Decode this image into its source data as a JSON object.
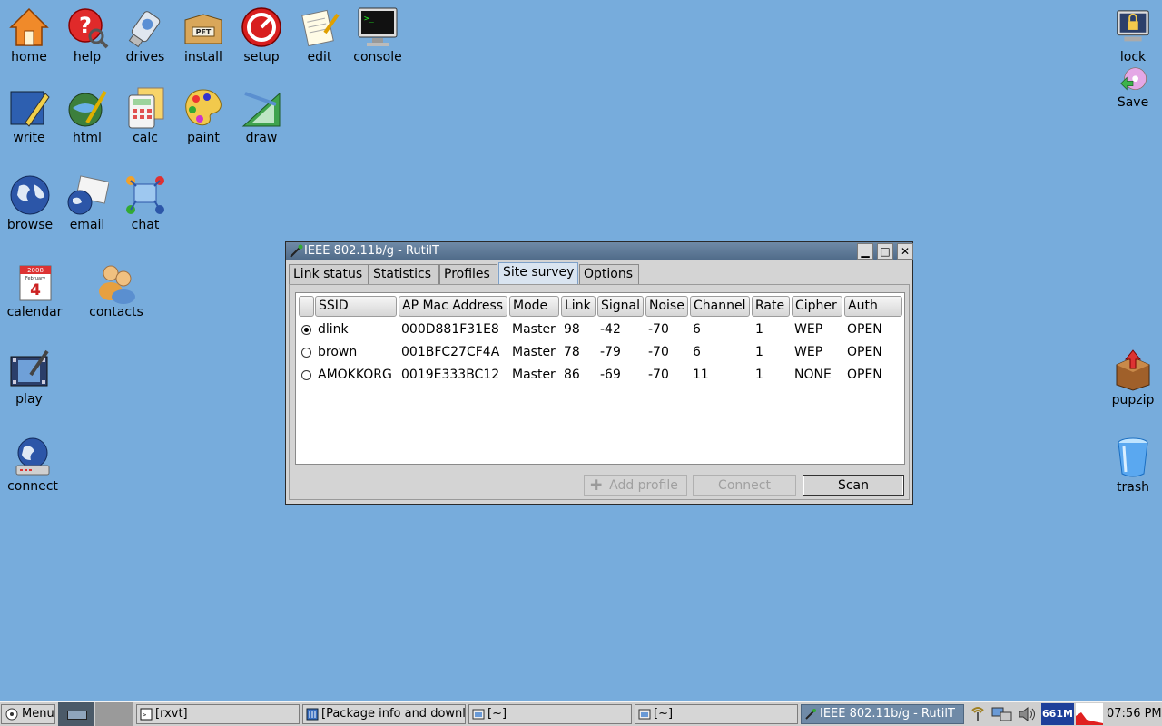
{
  "desktop_icons": {
    "home": "home",
    "help": "help",
    "drives": "drives",
    "install": "install",
    "setup": "setup",
    "edit": "edit",
    "console": "console",
    "write": "write",
    "html": "html",
    "calc": "calc",
    "paint": "paint",
    "draw": "draw",
    "browse": "browse",
    "email": "email",
    "chat": "chat",
    "calendar": "calendar",
    "contacts": "contacts",
    "play": "play",
    "connect": "connect",
    "lock": "lock",
    "save": "Save",
    "pupzip": "pupzip",
    "trash": "trash"
  },
  "icon_badges": {
    "install": "PET",
    "calendar_month": "February",
    "calendar_day": "4",
    "calendar_year": "2008"
  },
  "window": {
    "title": "IEEE 802.11b/g - RutilT",
    "tabs": [
      "Link status",
      "Statistics",
      "Profiles",
      "Site survey",
      "Options"
    ],
    "active_tab": "Site survey",
    "columns": [
      "SSID",
      "AP Mac Address",
      "Mode",
      "Link",
      "Signal",
      "Noise",
      "Channel",
      "Rate",
      "Cipher",
      "Auth"
    ],
    "rows": [
      {
        "selected": true,
        "ssid": "dlink",
        "mac": "000D881F31E8",
        "mode": "Master",
        "link": "98",
        "signal": "-42",
        "noise": "-70",
        "channel": "6",
        "rate": "1",
        "cipher": "WEP",
        "auth": "OPEN"
      },
      {
        "selected": false,
        "ssid": "brown",
        "mac": "001BFC27CF4A",
        "mode": "Master",
        "link": "78",
        "signal": "-79",
        "noise": "-70",
        "channel": "6",
        "rate": "1",
        "cipher": "WEP",
        "auth": "OPEN"
      },
      {
        "selected": false,
        "ssid": "AMOKKORG",
        "mac": "0019E333BC12",
        "mode": "Master",
        "link": "86",
        "signal": "-69",
        "noise": "-70",
        "channel": "11",
        "rate": "1",
        "cipher": "NONE",
        "auth": "OPEN"
      }
    ],
    "buttons": {
      "add_profile": "Add profile",
      "connect": "Connect",
      "scan": "Scan"
    }
  },
  "taskbar": {
    "menu": "Menu",
    "tasks": [
      "[rxvt]",
      "[Package info and downl",
      "[~]",
      "[~]",
      "IEEE 802.11b/g - RutilT"
    ],
    "memory": "661M",
    "clock": "07:56 PM"
  },
  "colors": {
    "desktop": "#77acdc",
    "titlebar": "#5a7695",
    "active_tab": "#d9e4f0"
  }
}
